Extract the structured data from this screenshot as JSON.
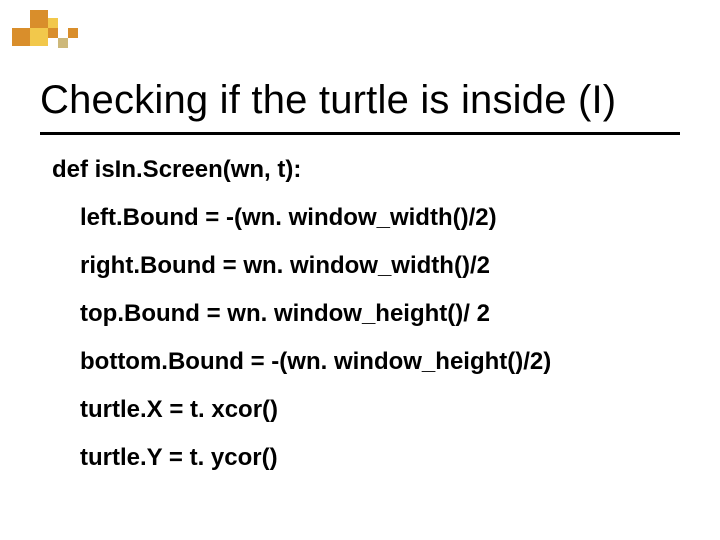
{
  "title": "Checking if the turtle is inside (I)",
  "code": {
    "def": "def isIn.Screen(wn, t):",
    "l1": "left.Bound = -(wn. window_width()/2)",
    "l2": "right.Bound = wn. window_width()/2",
    "l3": "top.Bound = wn. window_height()/ 2",
    "l4": "bottom.Bound = -(wn. window_height()/2)",
    "l5": "turtle.X = t. xcor()",
    "l6": "turtle.Y = t. ycor()"
  },
  "deco": {
    "colors": {
      "orange": "#d98e2b",
      "yellow": "#f2c84b",
      "tan": "#cdb87a"
    }
  }
}
